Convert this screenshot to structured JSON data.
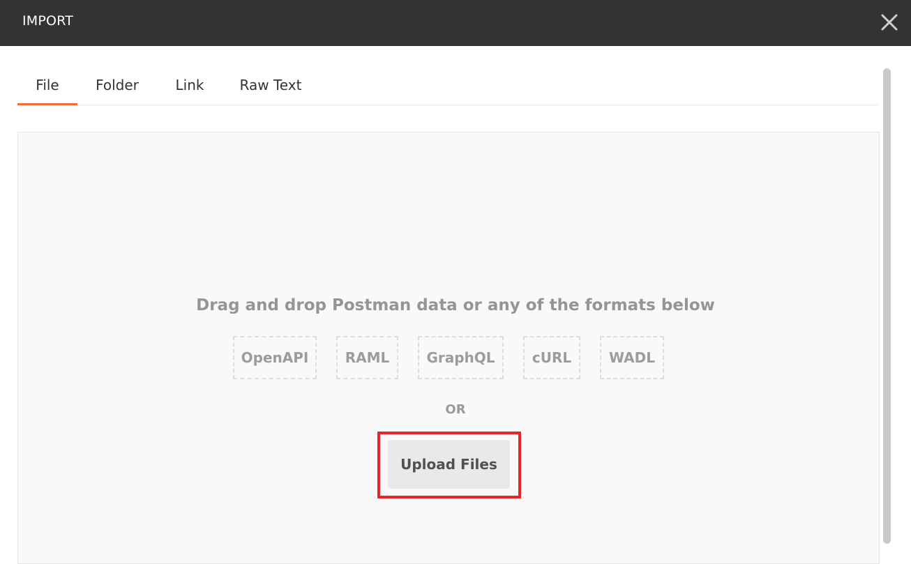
{
  "dialog": {
    "title": "IMPORT",
    "close_icon": "close-icon"
  },
  "tabs": [
    {
      "label": "File",
      "active": true
    },
    {
      "label": "Folder",
      "active": false
    },
    {
      "label": "Link",
      "active": false
    },
    {
      "label": "Raw Text",
      "active": false
    }
  ],
  "dropzone": {
    "hint": "Drag and drop Postman data or any of the formats below",
    "formats": [
      "OpenAPI",
      "RAML",
      "GraphQL",
      "cURL",
      "WADL"
    ],
    "or_label": "OR",
    "upload_label": "Upload Files"
  },
  "colors": {
    "titlebar": "#333333",
    "active_tab_underline": "#f26b3a",
    "highlight_border": "#e8252a"
  }
}
